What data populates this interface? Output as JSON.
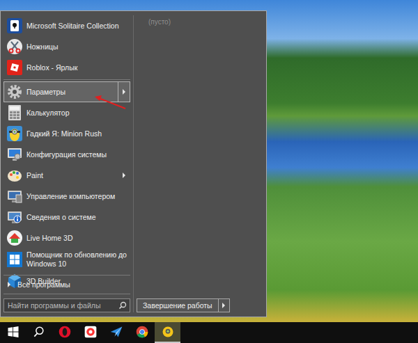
{
  "start_menu": {
    "items": [
      {
        "label": "Microsoft Solitaire Collection",
        "kind": "cards",
        "submenu": false,
        "selected": false
      },
      {
        "label": "Ножницы",
        "kind": "scissors",
        "submenu": false,
        "selected": false
      },
      {
        "label": "Roblox - Ярлык",
        "kind": "roblox",
        "submenu": false,
        "selected": false
      },
      {
        "label": "",
        "kind": "separator",
        "submenu": false,
        "selected": false
      },
      {
        "label": "Параметры",
        "kind": "gear",
        "submenu": true,
        "selected": true
      },
      {
        "label": "Калькулятор",
        "kind": "calculator",
        "submenu": false,
        "selected": false
      },
      {
        "label": "Гадкий Я: Minion Rush",
        "kind": "minion",
        "submenu": false,
        "selected": false
      },
      {
        "label": "Конфигурация системы",
        "kind": "config",
        "submenu": false,
        "selected": false
      },
      {
        "label": "Paint",
        "kind": "paint",
        "submenu": true,
        "selected": false
      },
      {
        "label": "Управление компьютером",
        "kind": "computer",
        "submenu": false,
        "selected": false
      },
      {
        "label": "Сведения о системе",
        "kind": "sysinfo",
        "submenu": false,
        "selected": false
      },
      {
        "label": "Live Home 3D",
        "kind": "home3d",
        "submenu": false,
        "selected": false
      },
      {
        "label": "Помощник по обновлению до Windows 10",
        "kind": "windows",
        "submenu": false,
        "selected": false
      },
      {
        "label": "3D Builder",
        "kind": "builder",
        "submenu": false,
        "selected": false
      }
    ],
    "all_programs": "Все программы",
    "search": {
      "placeholder": "Найти программы и файлы"
    },
    "recent": {
      "empty_label": "(пусто)"
    },
    "shutdown": {
      "label": "Завершение работы",
      "has_options": true
    }
  },
  "taskbar": {
    "items": [
      {
        "kind": "start",
        "active": false
      },
      {
        "kind": "search",
        "active": false
      },
      {
        "kind": "opera",
        "active": false
      },
      {
        "kind": "yandex",
        "active": false
      },
      {
        "kind": "plane",
        "active": false
      },
      {
        "kind": "chrome",
        "active": false
      },
      {
        "kind": "game",
        "active": true
      }
    ]
  }
}
